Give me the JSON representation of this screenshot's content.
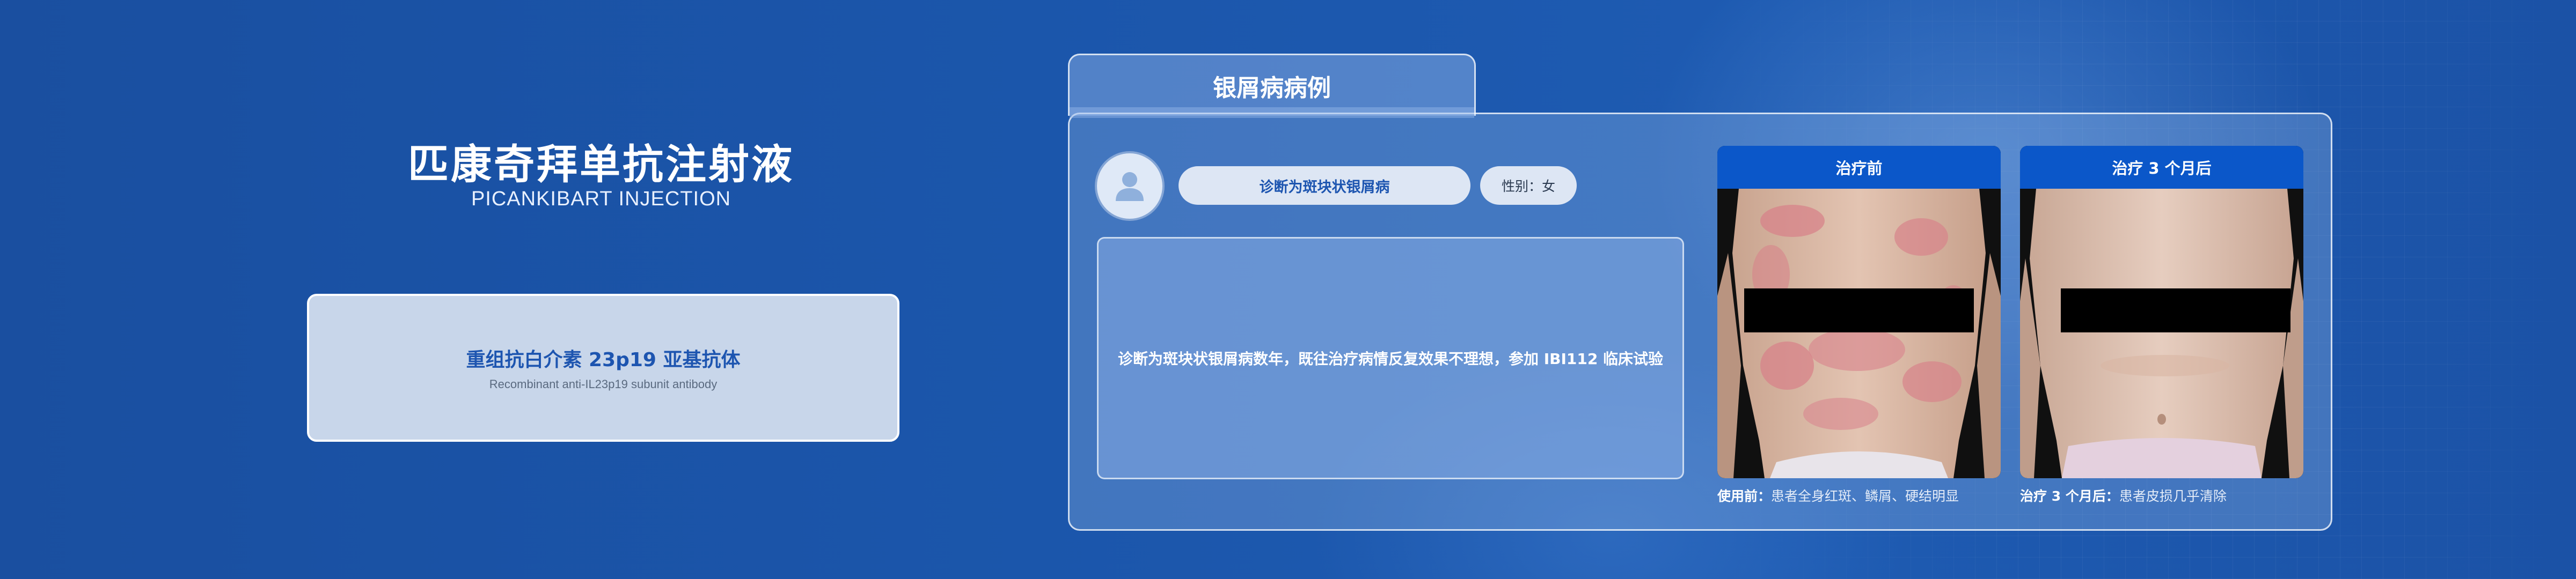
{
  "product": {
    "title_zh": "匹康奇拜单抗注射液",
    "title_en": "PICANKIBART INJECTION",
    "card_zh": "重组抗白介素 23p19 亚基抗体",
    "card_en": "Recombinant anti-IL23p19 subunit antibody"
  },
  "case": {
    "tab_title": "银屑病病例",
    "avatar_icon": "user-avatar-icon",
    "diagnosis": "诊断为斑块状银屑病",
    "gender": "性别：女",
    "history": "诊断为斑块状银屑病数年，既往治疗病情反复效果不理想，参加 IBI112 临床试验"
  },
  "photos": [
    {
      "label": "治疗前",
      "caption_bold": "使用前：",
      "caption_rest": "患者全身红斑、鳞屑、硬结明显"
    },
    {
      "label": "治疗 3 个月后",
      "caption_bold": "治疗 3 个月后：",
      "caption_rest": "患者皮损几乎清除"
    }
  ],
  "colors": {
    "background": "#1850a3",
    "accent": "#0b57c9",
    "card_text": "#1d55b0"
  }
}
